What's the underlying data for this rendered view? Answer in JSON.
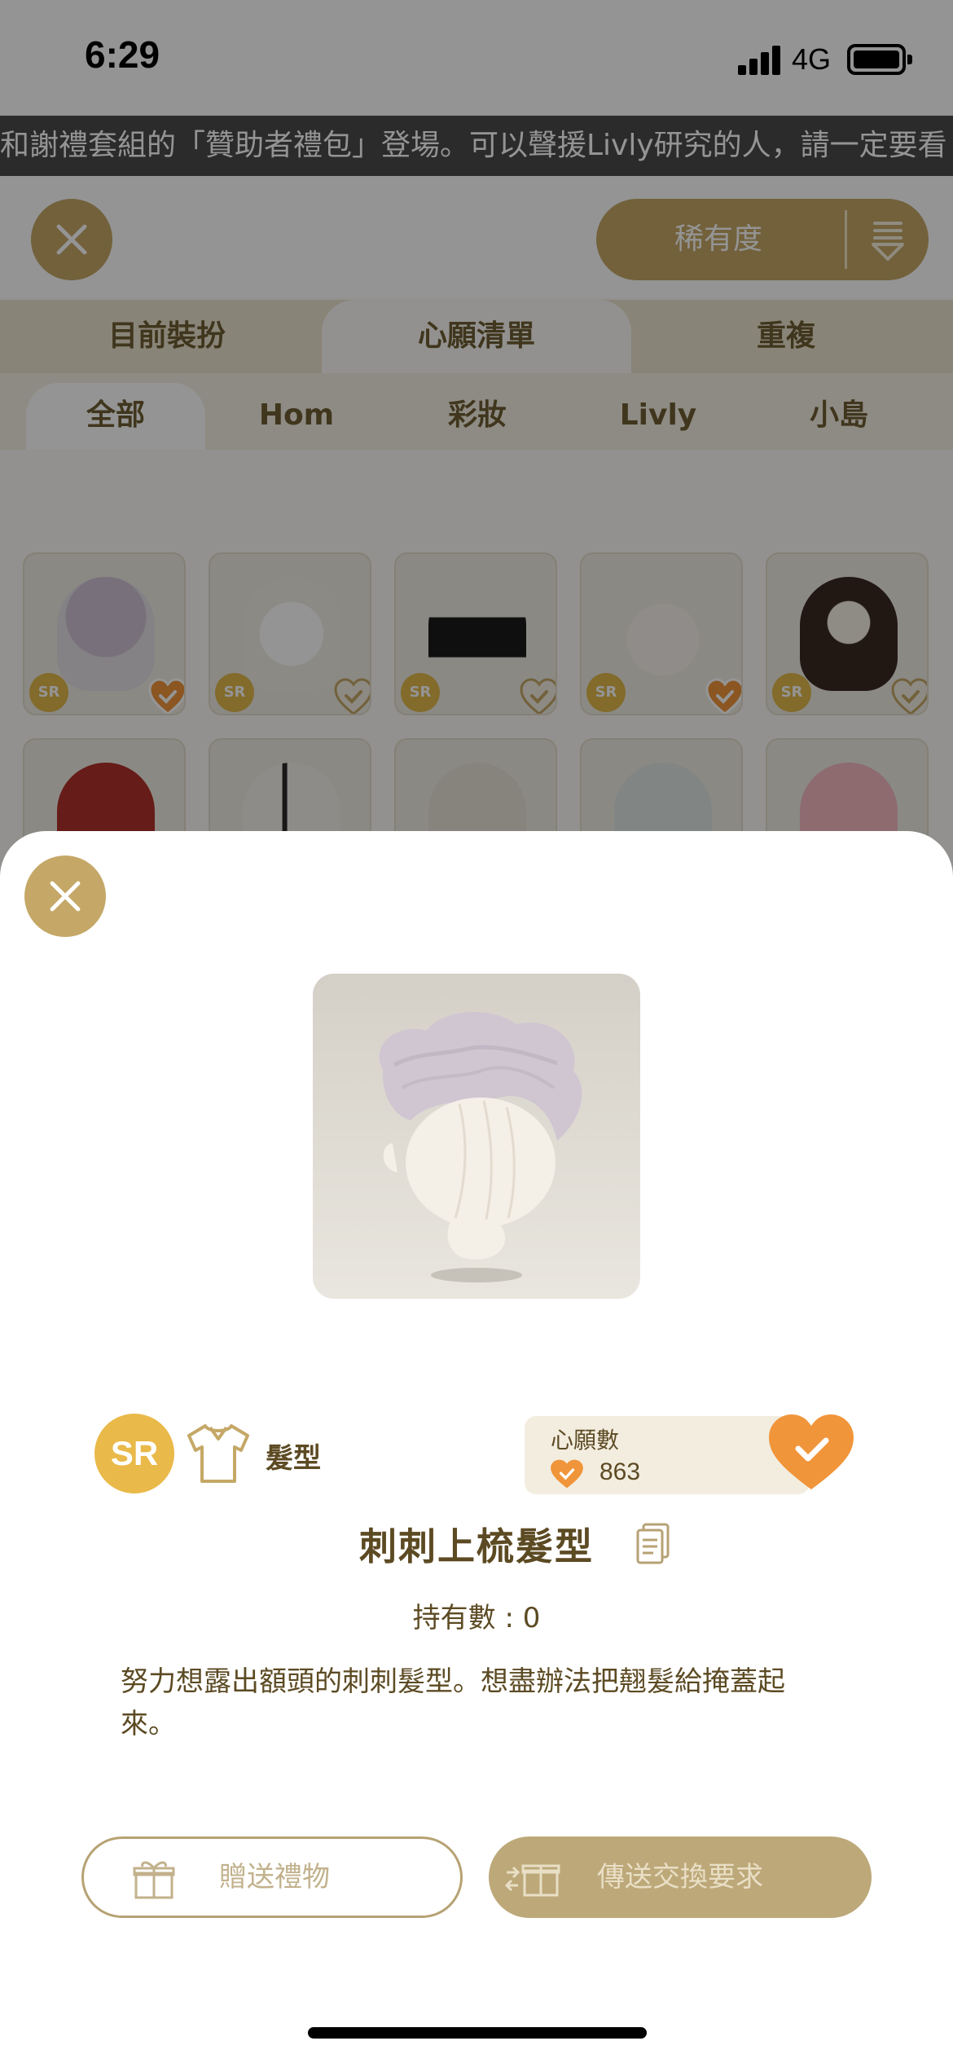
{
  "status_bar": {
    "time": "6:29",
    "network": "4G"
  },
  "ticker": {
    "text": "和謝禮套組的「贊助者禮包」登場。可以聲援Livly研究的人，請一定要看"
  },
  "top_bar": {
    "sort_label": "稀有度"
  },
  "main_tabs": [
    {
      "label": "目前裝扮",
      "active": false
    },
    {
      "label": "心願清單",
      "active": true
    },
    {
      "label": "重複",
      "active": false
    }
  ],
  "category_tabs": [
    {
      "label": "全部",
      "active": true
    },
    {
      "label": "Hom",
      "active": false
    },
    {
      "label": "彩妝",
      "active": false
    },
    {
      "label": "Livly",
      "active": false
    },
    {
      "label": "小島",
      "active": false
    }
  ],
  "grid": {
    "items": [
      {
        "rarity": "SR",
        "wished": true
      },
      {
        "rarity": "SR",
        "wished": false
      },
      {
        "rarity": "SR",
        "wished": false
      },
      {
        "rarity": "SR",
        "wished": true
      },
      {
        "rarity": "SR",
        "wished": false
      }
    ]
  },
  "detail": {
    "rarity": "SR",
    "category": "髮型",
    "wish_title": "心願數",
    "wish_count": "863",
    "item_name": "刺刺上梳髮型",
    "owned": "持有數 : 0",
    "description": "努力想露出額頭的刺刺髮型。想盡辦法把翹髮給掩蓋起來。",
    "gift_button": "贈送禮物",
    "trade_button": "傳送交換要求"
  },
  "colors": {
    "gold": "#c5a867",
    "sr_badge": "#e9b949",
    "wish_orange": "#f0953a",
    "text_brown": "#5c4a23"
  }
}
